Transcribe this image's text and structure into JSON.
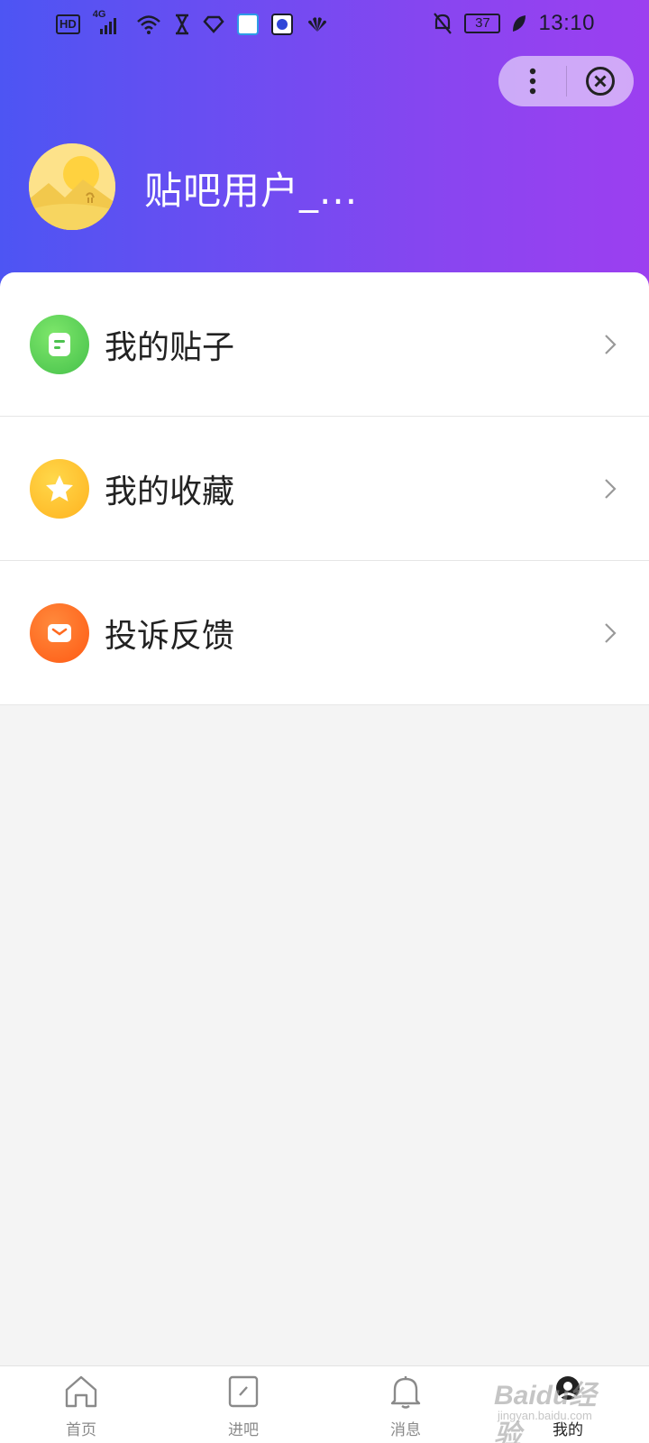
{
  "status_bar": {
    "hd_label": "HD",
    "network_label": "4G",
    "battery_level": "37",
    "time": "13:10"
  },
  "capsule": {
    "more_icon": "more-vertical-icon",
    "close_icon": "close-circle-icon"
  },
  "profile": {
    "username": "贴吧用户_..."
  },
  "menu": {
    "items": [
      {
        "label": "我的贴子",
        "icon": "post-icon",
        "color": "#5fd35c"
      },
      {
        "label": "我的收藏",
        "icon": "star-icon",
        "color": "#ffc62c"
      },
      {
        "label": "投诉反馈",
        "icon": "mail-icon",
        "color": "#ff6a1f"
      }
    ]
  },
  "tabbar": {
    "tabs": [
      {
        "label": "首页",
        "icon": "home-icon"
      },
      {
        "label": "进吧",
        "icon": "edit-box-icon"
      },
      {
        "label": "消息",
        "icon": "bell-icon"
      },
      {
        "label": "我的",
        "icon": "profile-icon",
        "active": true
      }
    ]
  },
  "watermark": {
    "text": "Baidu经验",
    "sub": "jingyan.baidu.com"
  },
  "colors": {
    "header_start": "#4d55f3",
    "header_end": "#9c3ff0",
    "background": "#f4f4f4"
  }
}
